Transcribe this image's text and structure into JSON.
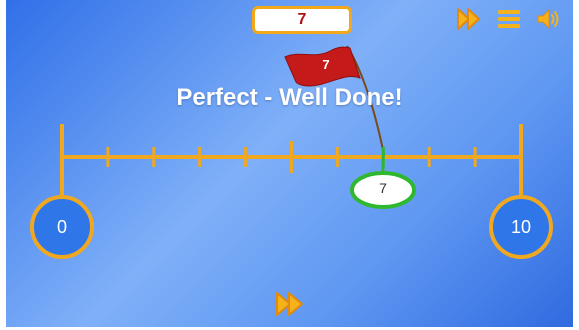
{
  "target": {
    "value": "7"
  },
  "toolbar": {
    "skip_icon": "fast-forward-icon",
    "menu_icon": "menu-icon",
    "sound_icon": "speaker-icon"
  },
  "feedback": {
    "message": "Perfect - Well Done!"
  },
  "flag": {
    "label": "7"
  },
  "number_line": {
    "start_label": "0",
    "end_label": "10",
    "answer_label": "7"
  },
  "colors": {
    "line": "#f0a820",
    "bubble_fill": "#2f77e8",
    "answer_ring": "#2fb82f",
    "flag": "#c51a1a",
    "target_text": "#b01010"
  }
}
